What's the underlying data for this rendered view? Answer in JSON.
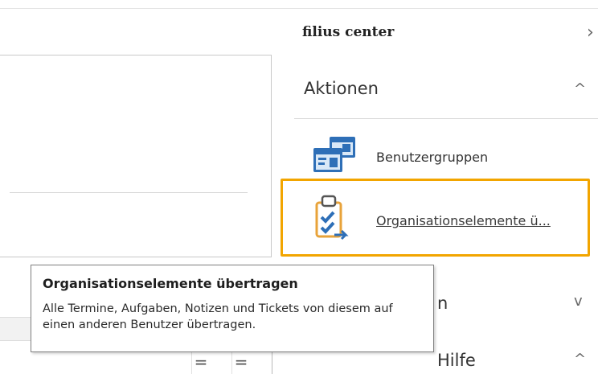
{
  "nav": {
    "header": "filius center",
    "header_arrow": "›"
  },
  "sections": {
    "aktionen_title": "Aktionen",
    "aktionen_chevron": "^",
    "hidden_section_suffix": "n",
    "hidden_section_chevron": "v",
    "hilfe_title": "Hilfe",
    "hilfe_chevron": "^"
  },
  "actions": [
    {
      "label": "Benutzergruppen",
      "icon": "user-groups-icon"
    },
    {
      "label": "Organisationselemente ü...",
      "icon": "clipboard-transfer-icon"
    }
  ],
  "tooltip": {
    "title": "Organisationselemente übertragen",
    "body": "Alle Termine, Aufgaben, Notizen und Tickets von diesem auf einen anderen Benutzer übertragen."
  },
  "toolbar": {
    "eq_glyph": "="
  },
  "colors": {
    "highlight": "#f2a500",
    "icon_blue": "#2e6fb7",
    "icon_orange": "#e8a33a"
  }
}
